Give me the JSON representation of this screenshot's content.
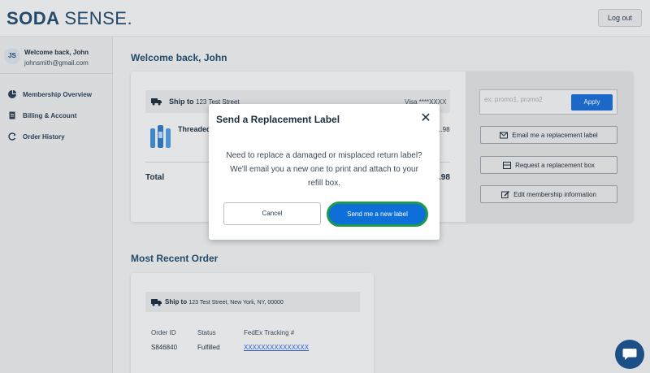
{
  "header": {
    "logo_bold": "SODA",
    "logo_thin": "SENSE.",
    "logout_label": "Log out"
  },
  "sidebar": {
    "user": {
      "initials": "JS",
      "name": "Welcome back, John",
      "email": "johnsmith@gmail.com"
    },
    "items": [
      {
        "label": "Membership Overview",
        "icon": "pie-chart-icon"
      },
      {
        "label": "Billing & Account",
        "icon": "document-icon"
      },
      {
        "label": "Order History",
        "icon": "refresh-icon"
      }
    ]
  },
  "main": {
    "welcome": "Welcome back, John",
    "card": {
      "ship_to_label": "Ship to",
      "ship_to_address": "123 Test Street",
      "payment": "Visa ****XXXX",
      "product_label": "Threaded",
      "product_price_partial": "1.98",
      "total_label": "Total",
      "total_partial": ".98"
    },
    "promo": {
      "placeholder": "ex: promo1, promo2",
      "apply_label": "Apply"
    },
    "actions": [
      {
        "label": "Email me a replacement label",
        "icon": "mail-icon"
      },
      {
        "label": "Request a replacement box",
        "icon": "box-icon"
      },
      {
        "label": "Edit membership information",
        "icon": "edit-icon"
      }
    ],
    "recent": {
      "title": "Most Recent Order",
      "ship_to_label": "Ship to",
      "ship_to_address": "123 Test Street, New York, NY, 00000",
      "columns": [
        "Order ID",
        "Status",
        "FedEx Tracking #"
      ],
      "row": {
        "order_id": "S846840",
        "status": "Fulfilled",
        "tracking": "XXXXXXXXXXXXXXX"
      }
    }
  },
  "modal": {
    "title": "Send a Replacement Label",
    "body": "Need to replace a damaged or misplaced return label? We'll email you a new one to print and attach to your refill box.",
    "cancel_label": "Cancel",
    "send_label": "Send me a new label"
  },
  "colors": {
    "brand": "#234a6b",
    "primary": "#0f6fd8",
    "focus_ring": "#1e9b4a"
  }
}
